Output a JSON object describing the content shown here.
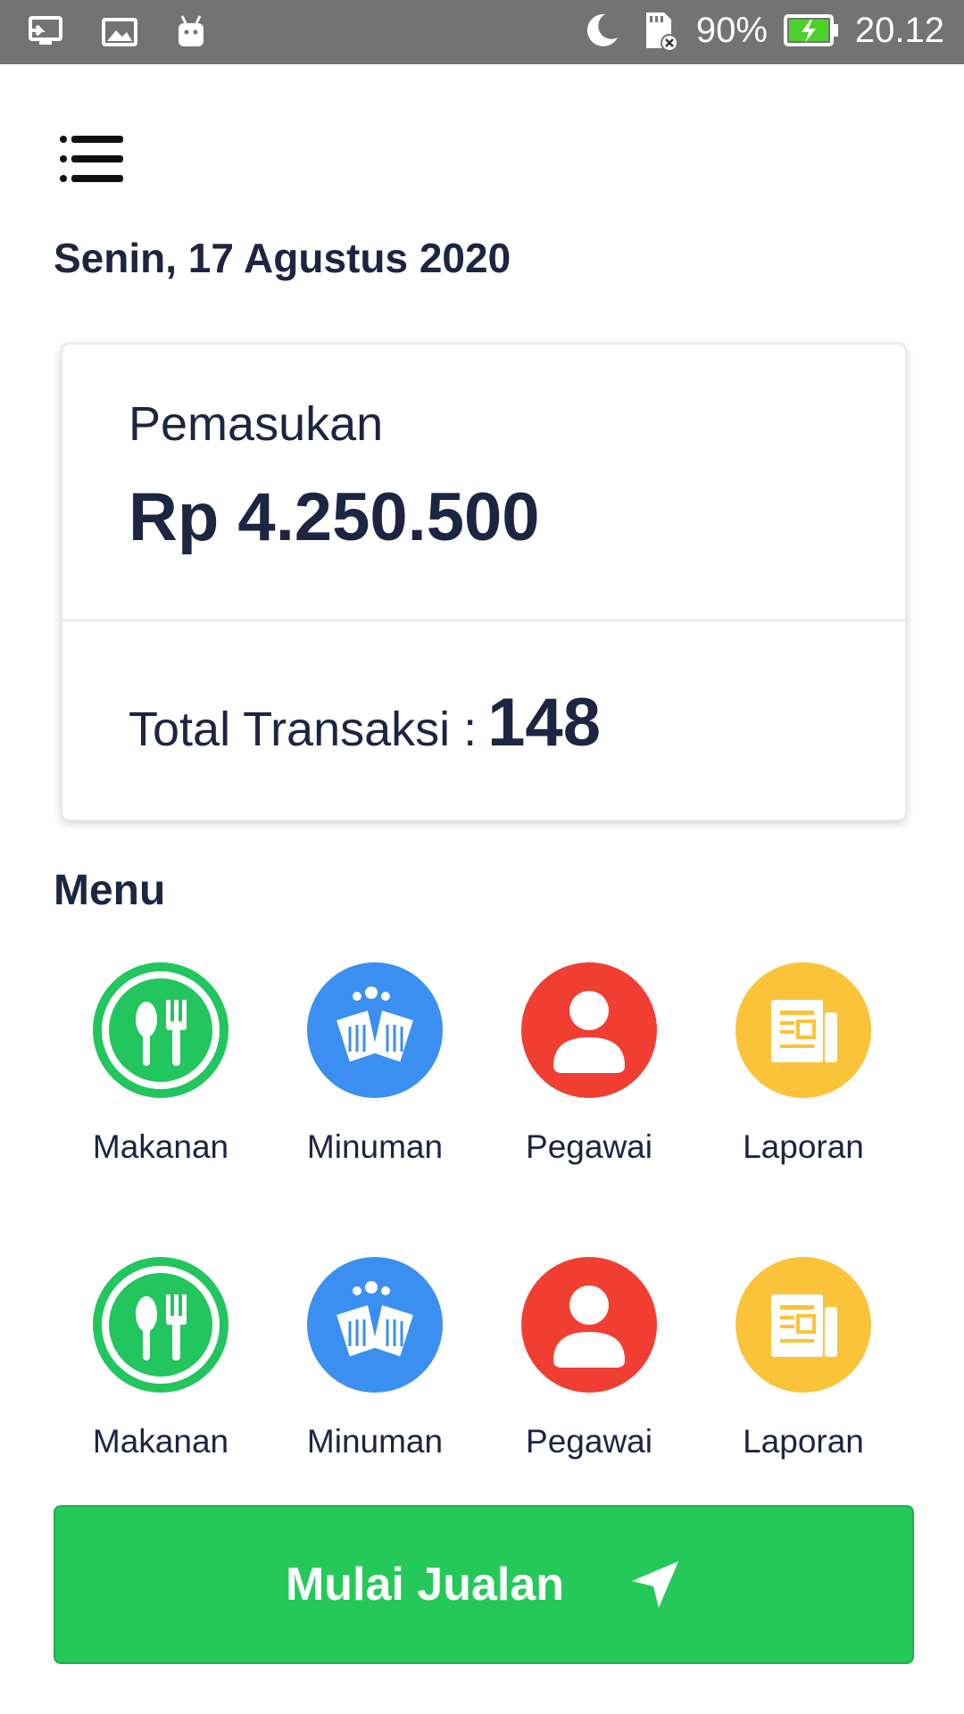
{
  "status_bar": {
    "battery": "90%",
    "time": "20.12",
    "icons": [
      "screen-cast-icon",
      "gallery-icon",
      "android-icon",
      "moon-icon",
      "sd-card-icon",
      "battery-charging-icon"
    ]
  },
  "header": {
    "menu_icon": "hamburger-icon",
    "date": "Senin, 17 Agustus 2020"
  },
  "summary": {
    "income_label": "Pemasukan",
    "income_value": "Rp 4.250.500",
    "transactions_label": "Total Transaksi :",
    "transactions_value": "148"
  },
  "menu": {
    "title": "Menu",
    "items": [
      {
        "label": "Makanan",
        "icon": "food-icon",
        "color": "#22c55e"
      },
      {
        "label": "Minuman",
        "icon": "drinks-icon",
        "color": "#3b8ff0"
      },
      {
        "label": "Pegawai",
        "icon": "employee-icon",
        "color": "#f03e33"
      },
      {
        "label": "Laporan",
        "icon": "report-icon",
        "color": "#fbc33a"
      },
      {
        "label": "Makanan",
        "icon": "food-icon",
        "color": "#22c55e"
      },
      {
        "label": "Minuman",
        "icon": "drinks-icon",
        "color": "#3b8ff0"
      },
      {
        "label": "Pegawai",
        "icon": "employee-icon",
        "color": "#f03e33"
      },
      {
        "label": "Laporan",
        "icon": "report-icon",
        "color": "#fbc33a"
      }
    ]
  },
  "start_button": {
    "label": "Mulai Jualan",
    "icon": "send-icon",
    "color": "#25c95a"
  }
}
